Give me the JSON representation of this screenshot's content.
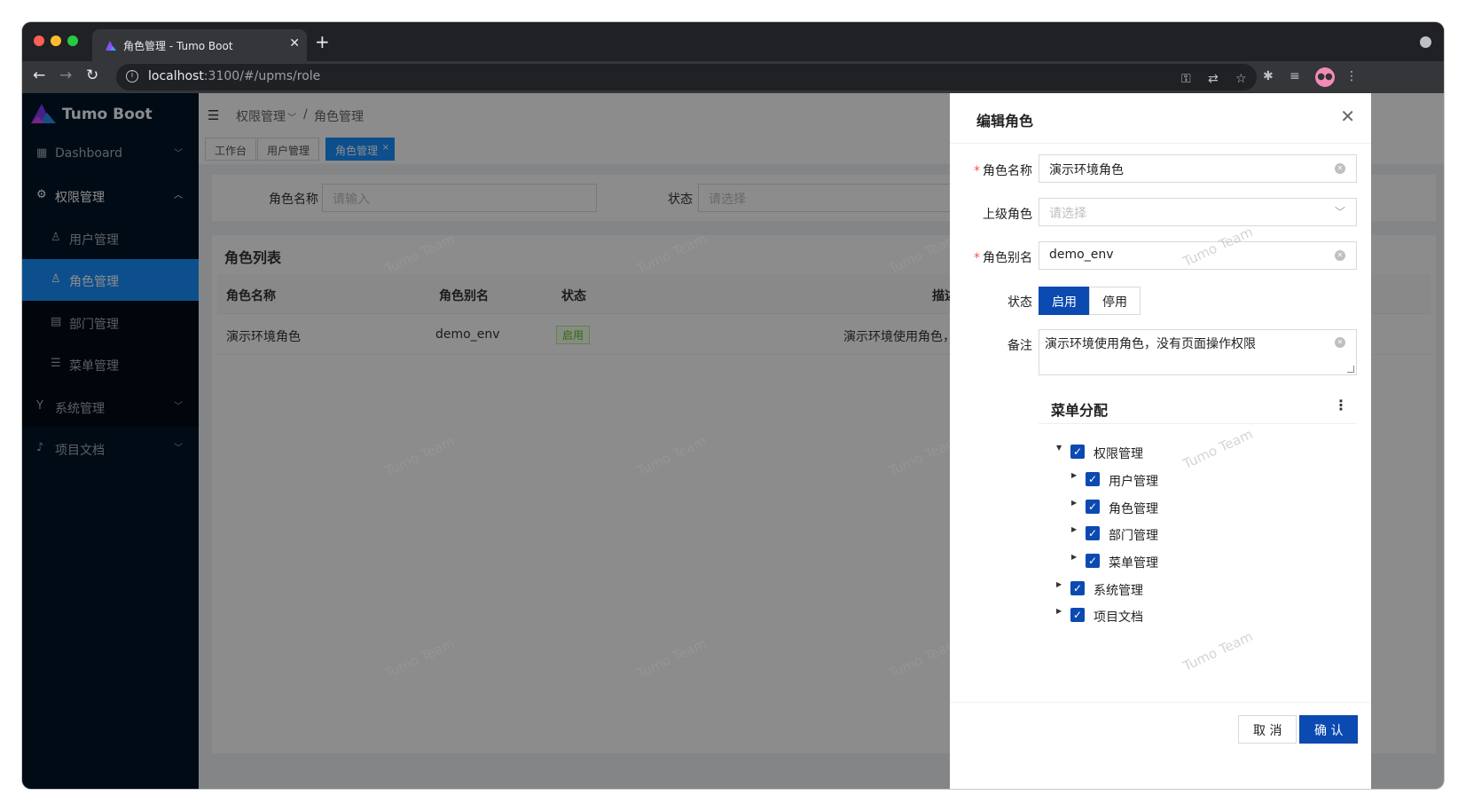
{
  "browser": {
    "tab_title": "角色管理 - Tumo Boot",
    "url_host": "localhost",
    "url_path": ":3100/#/upms/role"
  },
  "sidebar": {
    "brand": "Tumo Boot",
    "items": [
      {
        "label": "Dashboard"
      },
      {
        "label": "权限管理"
      },
      {
        "label": "用户管理"
      },
      {
        "label": "角色管理"
      },
      {
        "label": "部门管理"
      },
      {
        "label": "菜单管理"
      },
      {
        "label": "系统管理"
      },
      {
        "label": "项目文档"
      }
    ]
  },
  "header": {
    "breadcrumb": [
      "权限管理",
      "/",
      "角色管理"
    ]
  },
  "tags": [
    "工作台",
    "用户管理",
    "角色管理"
  ],
  "search": {
    "name_label": "角色名称",
    "name_placeholder": "请输入",
    "status_label": "状态",
    "status_placeholder": "请选择"
  },
  "table": {
    "title": "角色列表",
    "columns": [
      "角色名称",
      "角色别名",
      "状态",
      "描述"
    ],
    "rows": [
      {
        "name": "演示环境角色",
        "alias": "demo_env",
        "status": "启用",
        "desc": "演示环境使用角色，"
      }
    ]
  },
  "watermark": "Tumo Team",
  "drawer": {
    "title": "编辑角色",
    "fields": {
      "name_label": "角色名称",
      "name_value": "演示环境角色",
      "parent_label": "上级角色",
      "parent_placeholder": "请选择",
      "alias_label": "角色别名",
      "alias_value": "demo_env",
      "status_label": "状态",
      "status_on": "启用",
      "status_off": "停用",
      "remark_label": "备注",
      "remark_value": "演示环境使用角色，没有页面操作权限"
    },
    "tree": {
      "title": "菜单分配",
      "nodes": [
        "权限管理",
        "用户管理",
        "角色管理",
        "部门管理",
        "菜单管理",
        "系统管理",
        "项目文档"
      ]
    },
    "cancel": "取 消",
    "confirm": "确 认"
  }
}
